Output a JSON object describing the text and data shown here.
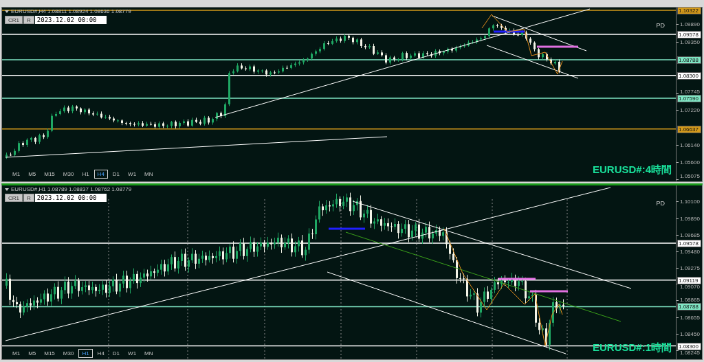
{
  "panels": [
    {
      "header": "EURUSD#,H4  1.08811 1.08924 1.08636 1.08779",
      "buttons": [
        "CR1",
        "R"
      ],
      "date": "2023.12.02 00:00",
      "marker": "PD",
      "timeframes": [
        {
          "label": "M1",
          "selected": false
        },
        {
          "label": "M5",
          "selected": false
        },
        {
          "label": "M15",
          "selected": false
        },
        {
          "label": "M30",
          "selected": false
        },
        {
          "label": "H1",
          "selected": false
        },
        {
          "label": "H4",
          "selected": true
        },
        {
          "label": "D1",
          "selected": false
        },
        {
          "label": "W1",
          "selected": false
        },
        {
          "label": "MN",
          "selected": false
        }
      ],
      "corner_label": "EURUSD#:4時間",
      "price_ticks": [
        "1.09890",
        "1.09350",
        "1.07745",
        "1.07220",
        "1.06140",
        "1.05600",
        "1.05075"
      ],
      "price_levels": [
        {
          "price": "1.10322",
          "color": "#d49a1a"
        },
        {
          "price": "1.09578",
          "color": "#ffffff"
        },
        {
          "price": "1.08788",
          "color": "#7fe6c4"
        },
        {
          "price": "1.08300",
          "color": "#ffffff"
        },
        {
          "price": "1.07590",
          "color": "#7fe6c4"
        },
        {
          "price": "1.06637",
          "color": "#d49a1a"
        }
      ]
    },
    {
      "header": "EURUSD#,H1  1.08789 1.08837 1.08762 1.08779",
      "buttons": [
        "CR1",
        "R"
      ],
      "date": "2023.12.02 00:00",
      "marker": "PD",
      "timeframes": [
        {
          "label": "M1",
          "selected": false
        },
        {
          "label": "M5",
          "selected": false
        },
        {
          "label": "M15",
          "selected": false
        },
        {
          "label": "M30",
          "selected": false
        },
        {
          "label": "H1",
          "selected": true
        },
        {
          "label": "H4",
          "selected": false
        },
        {
          "label": "D1",
          "selected": false
        },
        {
          "label": "W1",
          "selected": false
        },
        {
          "label": "MN",
          "selected": false
        }
      ],
      "corner_label": "EURUSD#:1時間",
      "price_ticks": [
        "1.10100",
        "1.09890",
        "1.09685",
        "1.09480",
        "1.09275",
        "1.09070",
        "1.08865",
        "1.08655",
        "1.08450",
        "1.08245"
      ],
      "price_levels": [
        {
          "price": "1.09578",
          "color": "#ffffff"
        },
        {
          "price": "1.09119",
          "color": "#ffffff"
        },
        {
          "price": "1.08788",
          "color": "#7fe6c4"
        },
        {
          "price": "1.08300",
          "color": "#ffffff"
        }
      ]
    }
  ]
}
